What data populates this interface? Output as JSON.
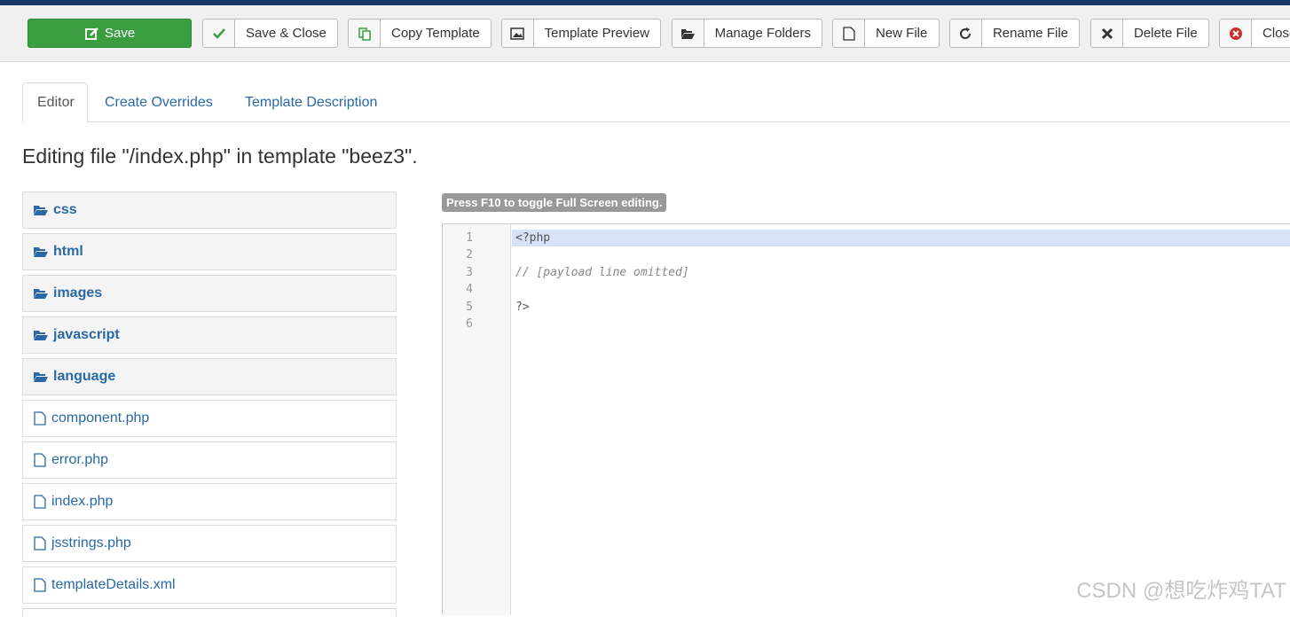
{
  "toolbar": {
    "save": "Save",
    "save_close": "Save & Close",
    "copy_template": "Copy Template",
    "template_preview": "Template Preview",
    "manage_folders": "Manage Folders",
    "new_file": "New File",
    "rename_file": "Rename File",
    "delete_file": "Delete File",
    "close": "Close"
  },
  "tabs": [
    {
      "label": "Editor",
      "active": true
    },
    {
      "label": "Create Overrides",
      "active": false
    },
    {
      "label": "Template Description",
      "active": false
    }
  ],
  "heading": "Editing file \"/index.php\" in template \"beez3\".",
  "tree": {
    "folders": [
      "css",
      "html",
      "images",
      "javascript",
      "language"
    ],
    "files": [
      "component.php",
      "error.php",
      "index.php",
      "jsstrings.php",
      "templateDetails.xml"
    ]
  },
  "editor": {
    "hint": "Press F10 to toggle Full Screen editing.",
    "line_numbers": [
      "1",
      "2",
      "3",
      "4",
      "5",
      "6"
    ],
    "lines": [
      "<?php",
      "",
      "// [payload line omitted]",
      "",
      "?>",
      ""
    ]
  },
  "watermark": "CSDN @想吃炸鸡TAT",
  "colors": {
    "topbar": "#1a3867",
    "save_button": "#3a9e40",
    "link": "#2a69a5",
    "active_line": "#d8e2f7"
  }
}
